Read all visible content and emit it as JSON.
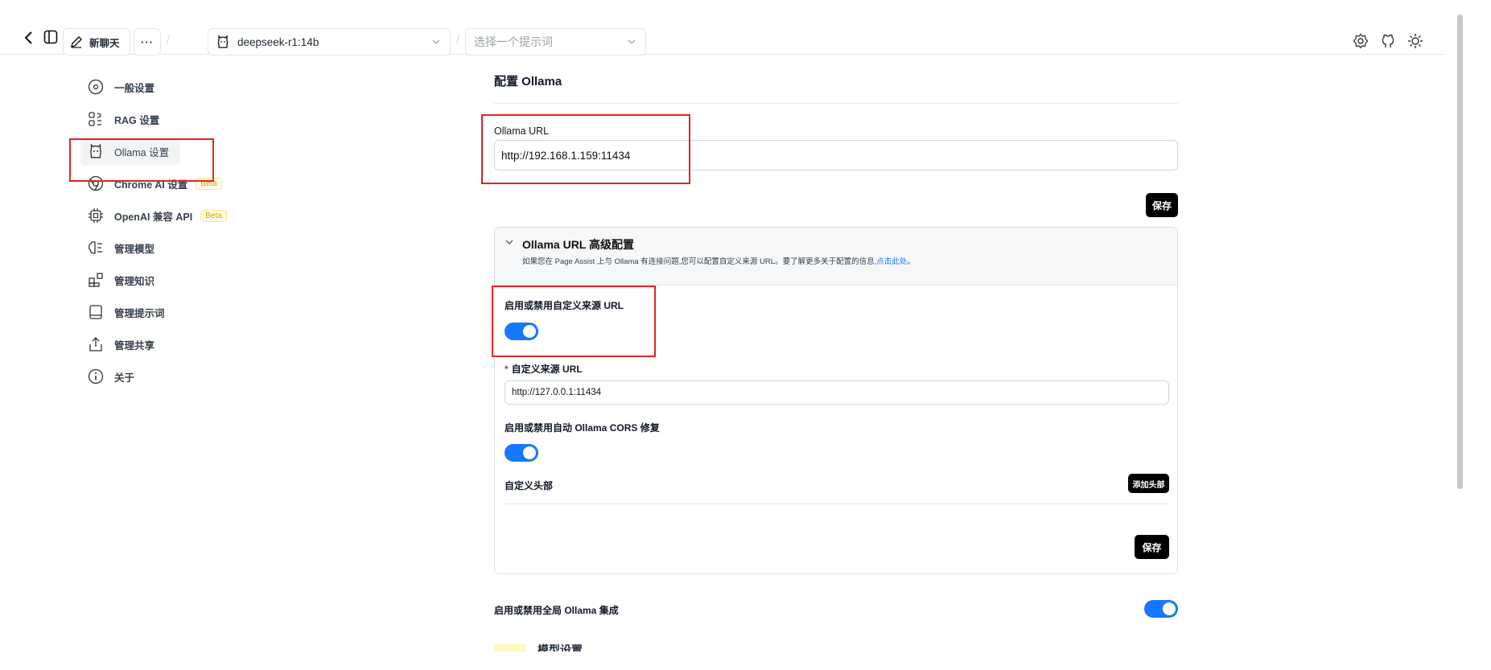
{
  "topbar": {
    "new_chat_label": "新聊天",
    "more_label": "···",
    "model_name": "deepseek-r1:14b",
    "prompt_placeholder": "选择一个提示词"
  },
  "sidebar": {
    "items": [
      {
        "label": "一般设置",
        "icon": "gear-circle-icon"
      },
      {
        "label": "RAG 设置",
        "icon": "rag-icon"
      },
      {
        "label": "Ollama 设置",
        "icon": "ollama-icon"
      },
      {
        "label": "Chrome AI 设置",
        "icon": "chrome-icon",
        "badge": "Beta"
      },
      {
        "label": "OpenAI 兼容 API",
        "icon": "cpu-icon",
        "badge": "Beta"
      },
      {
        "label": "管理模型",
        "icon": "brain-icon"
      },
      {
        "label": "管理知识",
        "icon": "blocks-icon"
      },
      {
        "label": "管理提示词",
        "icon": "book-icon"
      },
      {
        "label": "管理共享",
        "icon": "share-icon"
      },
      {
        "label": "关于",
        "icon": "info-icon"
      }
    ]
  },
  "main": {
    "title": "配置 Ollama",
    "ollama_url_label": "Ollama URL",
    "ollama_url_value": "http://192.168.1.159:11434",
    "save_label": "保存",
    "advanced": {
      "title": "Ollama URL 高级配置",
      "desc_prefix": "如果您在 Page Assist 上与 Ollama 有连接问题,您可以配置自定义来源 URL。要了解更多关于配置的信息,",
      "desc_link": "点击此处",
      "desc_suffix": "。",
      "custom_origin_toggle_label": "启用或禁用自定义来源 URL",
      "custom_origin_toggle_on": true,
      "required_mark": "*",
      "custom_origin_label": "自定义来源 URL",
      "custom_origin_value": "http://127.0.0.1:11434",
      "cors_toggle_label": "启用或禁用自动 Ollama CORS 修复",
      "cors_toggle_on": true,
      "custom_headers_label": "自定义头部",
      "add_header_label": "添加头部",
      "save_label": "保存"
    },
    "global_toggle_label": "启用或禁用全局 Ollama 集成",
    "global_toggle_on": true,
    "next_section_title": "模型设置"
  },
  "colors": {
    "accent": "#1677ff",
    "highlight_box": "#e02424"
  }
}
